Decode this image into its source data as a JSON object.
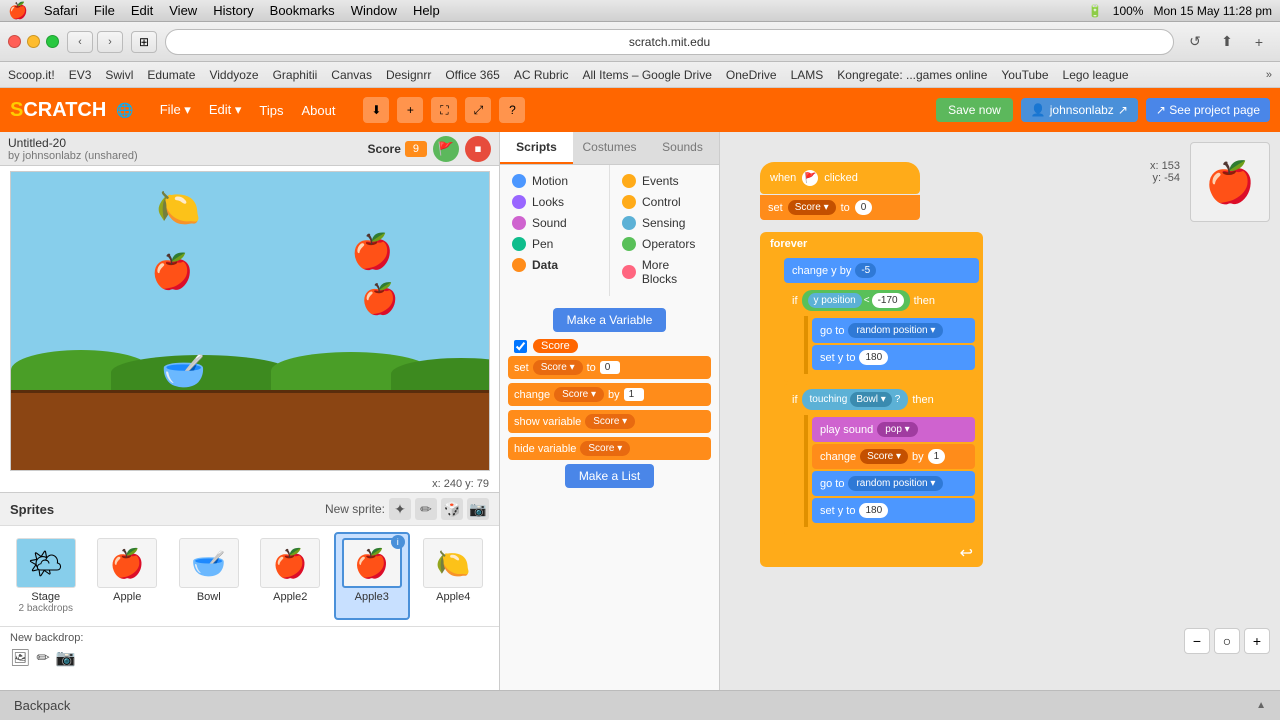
{
  "menubar": {
    "apple": "🍎",
    "items": [
      "Safari",
      "File",
      "Edit",
      "View",
      "History",
      "Bookmarks",
      "Window",
      "Help"
    ],
    "right": {
      "battery": "100%",
      "time": "Mon 15 May  11:28 pm"
    }
  },
  "browser": {
    "address": "scratch.mit.edu",
    "bookmarks": [
      "Scoop.it!",
      "EV3",
      "Swivl",
      "Edumate",
      "Viddyoze",
      "Graphitii",
      "Canvas",
      "Designrr",
      "Office 365",
      "AC Rubric",
      "All Items – Google Drive",
      "OneDrive",
      "LAMS",
      "Kongregate: ...games online",
      "YouTube",
      "Lego league"
    ],
    "nav": {
      "back": "‹",
      "forward": "›"
    }
  },
  "scratch": {
    "header": {
      "logo": "SCRATCH",
      "nav_items": [
        "File",
        "Edit",
        "Tips",
        "About"
      ],
      "save_btn": "Save now",
      "user": "johnsonlabz"
    },
    "project": {
      "name": "Untitled-20",
      "author": "by johnsonlabz (unshared)"
    },
    "score": {
      "label": "Score",
      "value": "9"
    },
    "tabs": {
      "scripts": "Scripts",
      "costumes": "Costumes",
      "sounds": "Sounds"
    },
    "categories": {
      "left": [
        "Motion",
        "Looks",
        "Sound",
        "Pen",
        "Data"
      ],
      "right": [
        "Events",
        "Control",
        "Sensing",
        "Operators",
        "More Blocks"
      ]
    },
    "palette_blocks": {
      "set_score": "set Score to 0",
      "change_score": "change Score by 1",
      "show_variable": "show variable Score",
      "hide_variable": "hide variable Score"
    },
    "make_variable": "Make a Variable",
    "make_list": "Make a List",
    "variable_name": "Score",
    "coords": {
      "x": "x: 240",
      "y": "y: 79"
    },
    "sprite_coords": {
      "x": "x: 153",
      "y": "y: -54"
    },
    "sprites": [
      {
        "name": "Stage",
        "sub": "2 backdrops",
        "emoji": "🌤",
        "type": "stage"
      },
      {
        "name": "Apple",
        "emoji": "🍎"
      },
      {
        "name": "Bowl",
        "emoji": "🥣"
      },
      {
        "name": "Apple2",
        "emoji": "🍎"
      },
      {
        "name": "Apple3",
        "emoji": "🍎",
        "selected": true,
        "info": true
      },
      {
        "name": "Apple4",
        "emoji": "🍋"
      }
    ],
    "blocks": {
      "when_clicked": "when 🚩 clicked",
      "set_score_0": "set",
      "forever": "forever",
      "change_y": "change y by",
      "change_y_val": "-5",
      "if_label": "if",
      "then_label": "then",
      "y_position": "y position",
      "less_than": "<",
      "y_threshold": "-170",
      "go_to_random1": "go to",
      "random_pos1": "random position",
      "set_y_180a": "set y to",
      "y_val_180a": "180",
      "touching": "touching",
      "bowl_label": "Bowl",
      "play_sound": "play sound",
      "pop_label": "pop",
      "change_score_1": "change",
      "score_by_1": "by",
      "score_val_1": "1",
      "go_to_random2": "go to",
      "random_pos2": "random position",
      "set_y_180b": "set y to",
      "y_val_180b": "180"
    },
    "backpack": "Backpack"
  }
}
